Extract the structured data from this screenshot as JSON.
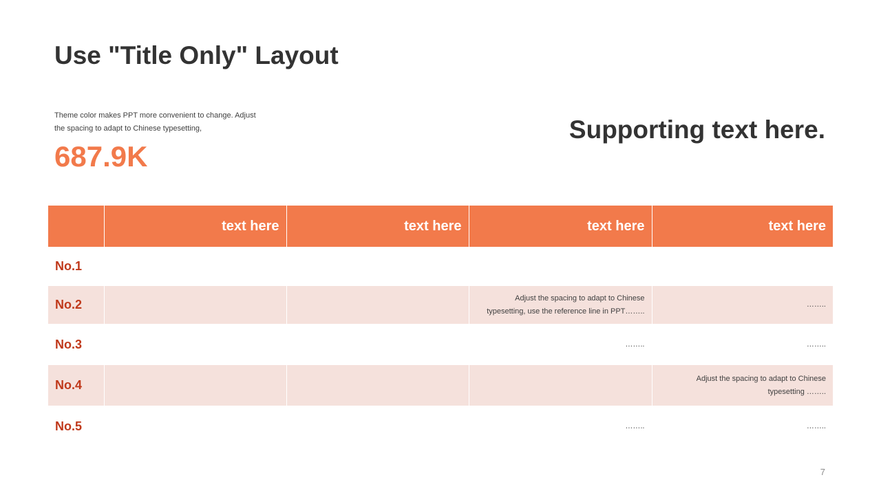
{
  "slide": {
    "title": "Use \"Title Only\" Layout",
    "description": "Theme color makes PPT more convenient  to change. Adjust the spacing to adapt to Chinese typesetting,",
    "big_number": "687.9K",
    "supporting_text": "Supporting text here.",
    "page_number": "7",
    "accent_color": "#f27a4b",
    "row_label_color": "#c0391b",
    "shade_color": "#f5e1dc"
  },
  "table": {
    "headers": [
      "",
      "text here",
      "text here",
      "text here",
      "text here"
    ],
    "rows": [
      {
        "label": "No.1",
        "cells": [
          "",
          "",
          "",
          ""
        ]
      },
      {
        "label": "No.2",
        "cells": [
          "",
          "",
          "Adjust the spacing to adapt to Chinese typesetting, use the reference line in PPT……..",
          "…….."
        ]
      },
      {
        "label": "No.3",
        "cells": [
          "",
          "",
          "……..",
          "…….."
        ]
      },
      {
        "label": "No.4",
        "cells": [
          "",
          "",
          "",
          "Adjust the spacing to adapt to Chinese typesetting …….."
        ]
      },
      {
        "label": "No.5",
        "cells": [
          "",
          "",
          "……..",
          "…….."
        ]
      }
    ]
  }
}
